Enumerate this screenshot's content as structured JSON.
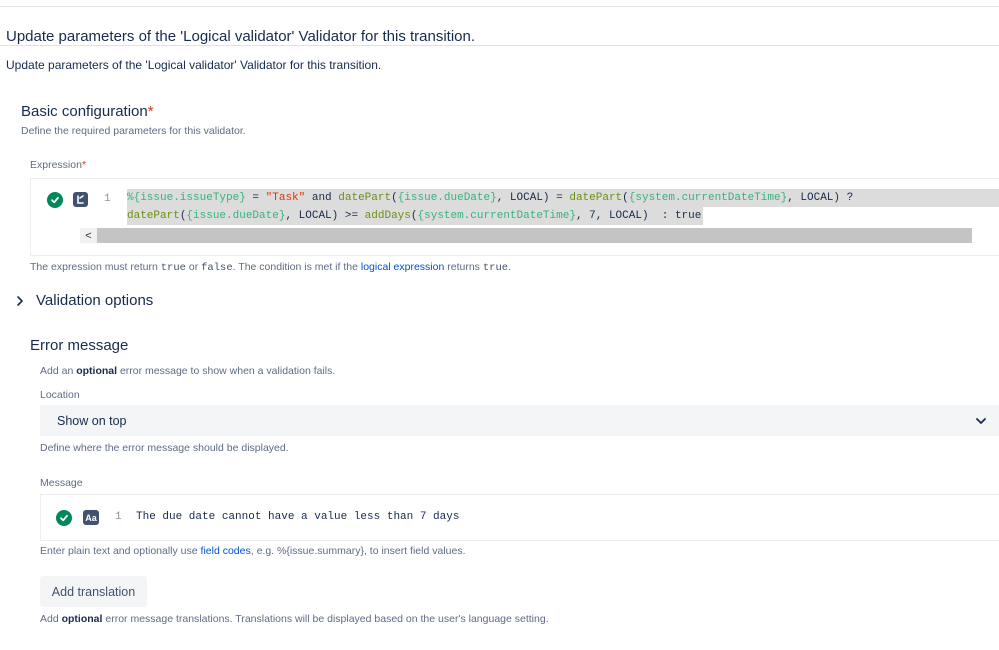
{
  "header": {
    "title": "Update parameters of the 'Logical validator' Validator for this transition.",
    "subtitle": "Update parameters of the 'Logical validator' Validator for this transition."
  },
  "basic_config": {
    "heading": "Basic configuration",
    "required_mark": "*",
    "help": "Define the required parameters for this validator."
  },
  "expression": {
    "label": "Expression",
    "required_mark": "*",
    "line_number": "1",
    "lines": [
      [
        {
          "t": "field",
          "v": "%{issue.issueType}"
        },
        {
          "t": "plain",
          "v": " = "
        },
        {
          "t": "str",
          "v": "\"Task\""
        },
        {
          "t": "plain",
          "v": " and "
        },
        {
          "t": "fn",
          "v": "datePart"
        },
        {
          "t": "plain",
          "v": "("
        },
        {
          "t": "field",
          "v": "{issue.dueDate}"
        },
        {
          "t": "plain",
          "v": ", LOCAL) = "
        },
        {
          "t": "fn",
          "v": "datePart"
        },
        {
          "t": "plain",
          "v": "("
        },
        {
          "t": "field",
          "v": "{system.currentDateTime}"
        },
        {
          "t": "plain",
          "v": ", LOCAL) ?"
        }
      ],
      [
        {
          "t": "fn",
          "v": "datePart"
        },
        {
          "t": "plain",
          "v": "("
        },
        {
          "t": "field",
          "v": "{issue.dueDate}"
        },
        {
          "t": "plain",
          "v": ", LOCAL) >= "
        },
        {
          "t": "fn",
          "v": "addDays"
        },
        {
          "t": "plain",
          "v": "("
        },
        {
          "t": "field",
          "v": "{system.currentDateTime}"
        },
        {
          "t": "plain",
          "v": ", 7, LOCAL)  : true"
        }
      ]
    ],
    "help_before_true": "The expression must return ",
    "help_true": "true",
    "help_or": " or ",
    "help_false": "false",
    "help_mid": ". The condition is met if the ",
    "help_link": "logical expression",
    "help_after": " returns ",
    "help_true2": "true",
    "help_end": ".",
    "scroll_left_glyph": "<",
    "lang_icon": "code-language-icon"
  },
  "validation_options": {
    "label": "Validation options"
  },
  "error_message": {
    "heading": "Error message",
    "help_pre": "Add an ",
    "help_bold": "optional",
    "help_post": " error message to show when a validation fails.",
    "location_label": "Location",
    "location_value": "Show on top",
    "location_help": "Define where the error message should be displayed.",
    "message_label": "Message",
    "message_badge": "Aa",
    "message_line_number": "1",
    "message_text": "The due date cannot have a value less than 7 days",
    "message_help_pre": "Enter plain text and optionally use ",
    "message_help_link": "field codes",
    "message_help_post": ", e.g. %{issue.summary}, to insert field values.",
    "add_translation": "Add translation",
    "translation_help_pre": "Add ",
    "translation_help_bold": "optional",
    "translation_help_post": " error message translations. Translations will be displayed based on the user's language setting."
  },
  "colors": {
    "success": "#00875a",
    "link": "#0052cc",
    "required": "#de350b",
    "field_token": "#36b37e",
    "string_token": "#de350b"
  }
}
